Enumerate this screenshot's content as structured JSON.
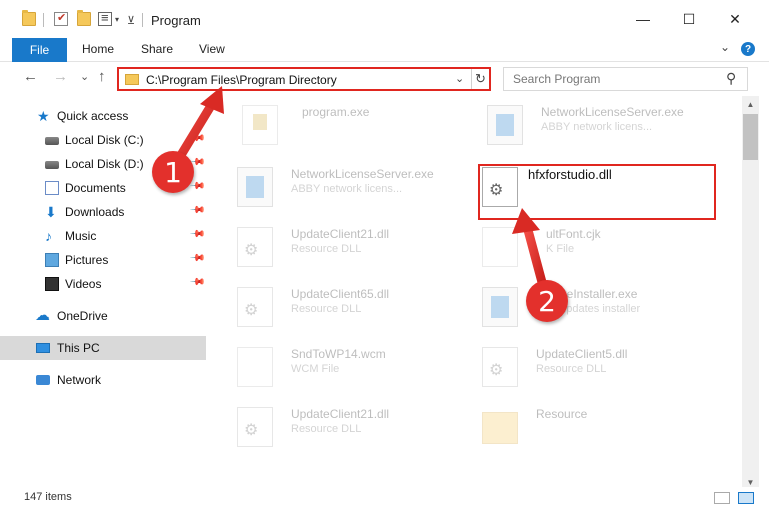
{
  "window": {
    "title": "Program",
    "minimize": "—",
    "maximize": "☐",
    "close": "✕"
  },
  "ribbon": {
    "file": "File",
    "tabs": [
      "Home",
      "Share",
      "View"
    ],
    "expand": "⌄",
    "help": "?"
  },
  "nav": {
    "back": "←",
    "forward": "→",
    "recent": "⌄",
    "up": "↑",
    "address": "C:\\Program Files\\Program Directory",
    "address_drop": "⌄",
    "refresh": "↻",
    "search_placeholder": "Search Program",
    "search_icon": "⚲"
  },
  "sidebar": {
    "items": [
      {
        "label": "Quick access",
        "icon": "star-icon"
      },
      {
        "label": "Local Disk (C:)",
        "icon": "disk-icon"
      },
      {
        "label": "Local Disk (D:)",
        "icon": "disk-icon"
      },
      {
        "label": "Documents",
        "icon": "documents-icon"
      },
      {
        "label": "Downloads",
        "icon": "downloads-icon"
      },
      {
        "label": "Music",
        "icon": "music-icon"
      },
      {
        "label": "Pictures",
        "icon": "pictures-icon"
      },
      {
        "label": "Videos",
        "icon": "videos-icon"
      },
      {
        "label": "OneDrive",
        "icon": "cloud-icon"
      },
      {
        "label": "This PC",
        "icon": "pc-icon"
      },
      {
        "label": "Network",
        "icon": "network-icon"
      }
    ],
    "selected": "This PC"
  },
  "files": [
    {
      "name": "program.exe",
      "sub": "",
      "icon": "program-icon"
    },
    {
      "name": "NetworkLicenseServer.exe",
      "sub": "ABBY network licens...",
      "icon": "exe-icon"
    },
    {
      "name": "NetworkLicenseServer.exe",
      "sub": "ABBY network licens...",
      "icon": "exe-icon"
    },
    {
      "name": "hfxforstudio.dll",
      "sub": "",
      "icon": "dll-icon"
    },
    {
      "name": "UpdateClient21.dll",
      "sub": "Resource DLL",
      "icon": "dll-icon"
    },
    {
      "name": "ultFont.cjk",
      "sub": "K File",
      "icon": "file-icon"
    },
    {
      "name": "UpdateClient65.dll",
      "sub": "Resource DLL",
      "icon": "dll-icon"
    },
    {
      "name": "lateInstaller.exe",
      "sub": "t updates installer",
      "icon": "exe-icon"
    },
    {
      "name": "SndToWP14.wcm",
      "sub": "WCM File",
      "icon": "file-icon"
    },
    {
      "name": "UpdateClient5.dll",
      "sub": "Resource DLL",
      "icon": "dll-icon"
    },
    {
      "name": "UpdateClient21.dll",
      "sub": "Resource DLL",
      "icon": "dll-icon"
    },
    {
      "name": "Resource",
      "sub": "",
      "icon": "folder-icon"
    }
  ],
  "status": {
    "count": "147 items"
  },
  "annotations": {
    "step1": "1",
    "step2": "2",
    "accent": "#e0261f"
  }
}
